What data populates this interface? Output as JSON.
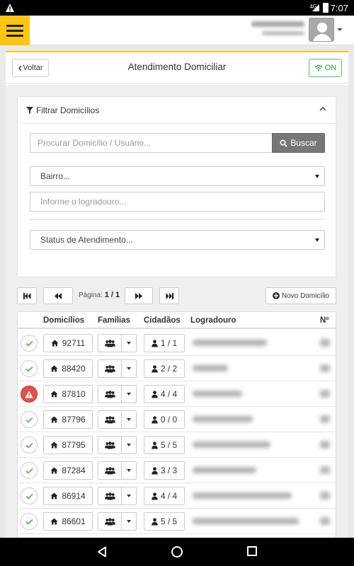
{
  "status_bar": {
    "network": "4G",
    "time": "7:07"
  },
  "header": {
    "user_name": "",
    "user_role": ""
  },
  "page": {
    "back_label": "Voltar",
    "title": "Atendimento Domiciliar",
    "online_label": "ON"
  },
  "filter": {
    "title": "Filtrar Domicílios",
    "search_placeholder": "Procurar Domicílio / Usuário...",
    "search_button": "Buscar",
    "bairro_selected": "Bairro...",
    "logradouro_placeholder": "Informe o logradouro...",
    "status_selected": "Status de Atendimento..."
  },
  "pagination": {
    "page_prefix": "Página:",
    "page_value": "1 / 1",
    "new_button": "Novo Domicílio"
  },
  "table": {
    "columns": [
      "Domicílios",
      "Famílias",
      "Cidadãos",
      "Logradouro",
      "Nº"
    ],
    "rows": [
      {
        "status": "ok",
        "domicilio": "92711",
        "cidadaos": "1 / 1"
      },
      {
        "status": "ok",
        "domicilio": "88420",
        "cidadaos": "2 / 2"
      },
      {
        "status": "alert",
        "domicilio": "87810",
        "cidadaos": "4 / 4"
      },
      {
        "status": "ok",
        "domicilio": "87796",
        "cidadaos": "0 / 0"
      },
      {
        "status": "ok",
        "domicilio": "87795",
        "cidadaos": "5 / 5"
      },
      {
        "status": "ok",
        "domicilio": "87284",
        "cidadaos": "3 / 3"
      },
      {
        "status": "ok",
        "domicilio": "86914",
        "cidadaos": "4 / 4"
      },
      {
        "status": "ok",
        "domicilio": "86601",
        "cidadaos": "5 / 5"
      }
    ]
  },
  "colors": {
    "accent": "#fcc616",
    "success": "#5cb85c",
    "danger": "#d9534f",
    "search_button": "#777777"
  },
  "icons": [
    "warning-icon",
    "menu-icon",
    "avatar-icon",
    "chevron-left-icon",
    "wifi-icon",
    "filter-icon",
    "chevron-up-icon",
    "search-icon",
    "step-backward-icon",
    "backward-icon",
    "forward-icon",
    "step-forward-icon",
    "plus-circle-icon",
    "check-icon",
    "home-icon",
    "users-icon",
    "user-icon",
    "nav-back-icon",
    "nav-home-icon",
    "nav-recent-icon"
  ]
}
